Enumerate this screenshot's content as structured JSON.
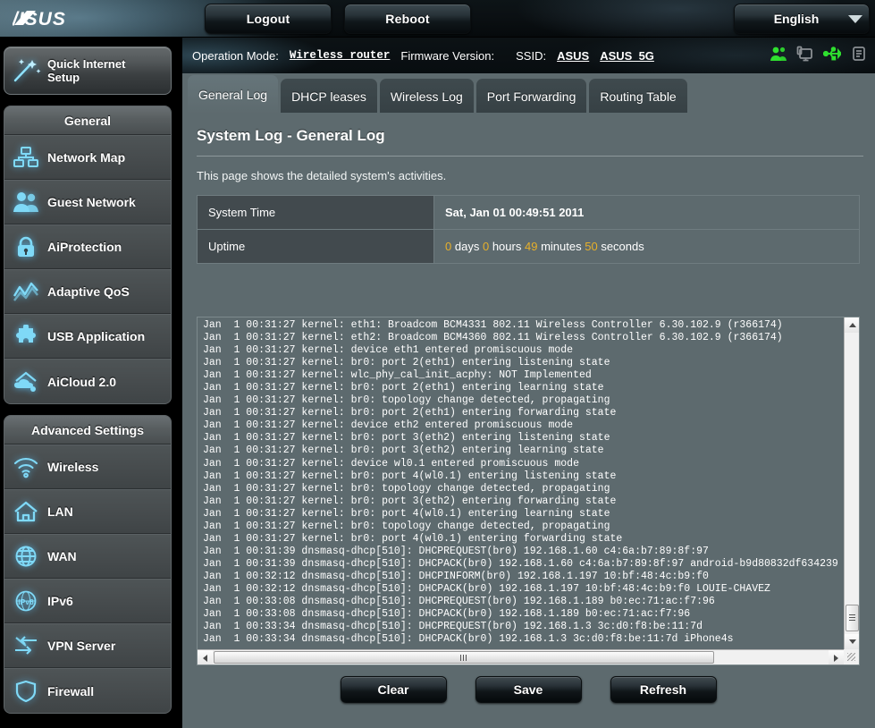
{
  "header": {
    "logo_text": "ASUS",
    "logout_label": "Logout",
    "reboot_label": "Reboot",
    "language_label": "English"
  },
  "opbar": {
    "operation_mode_label": "Operation Mode:",
    "operation_mode_value": "Wireless router",
    "firmware_label": "Firmware Version:",
    "firmware_value": "",
    "ssid_label": "SSID:",
    "ssid_value_1": "ASUS",
    "ssid_value_2": "ASUS_5G",
    "icons": [
      "clients-icon",
      "monitor-icon",
      "usb-icon",
      "printer-icon"
    ]
  },
  "sidebar": {
    "quick_setup": {
      "line1": "Quick Internet",
      "line2": "Setup",
      "icon": "magic-wand-icon"
    },
    "general_header": "General",
    "general_items": [
      {
        "label": "Network Map",
        "icon": "network-map-icon"
      },
      {
        "label": "Guest Network",
        "icon": "guest-network-icon"
      },
      {
        "label": "AiProtection",
        "icon": "lock-icon"
      },
      {
        "label": "Adaptive QoS",
        "icon": "chart-icon"
      },
      {
        "label": "USB Application",
        "icon": "puzzle-icon"
      },
      {
        "label": "AiCloud 2.0",
        "icon": "cloud-home-icon"
      }
    ],
    "advanced_header": "Advanced Settings",
    "advanced_items": [
      {
        "label": "Wireless",
        "icon": "wifi-icon"
      },
      {
        "label": "LAN",
        "icon": "home-icon"
      },
      {
        "label": "WAN",
        "icon": "globe-icon"
      },
      {
        "label": "IPv6",
        "icon": "ipv6-globe-icon"
      },
      {
        "label": "VPN Server",
        "icon": "vpn-arrows-icon"
      },
      {
        "label": "Firewall",
        "icon": "shield-icon"
      }
    ]
  },
  "tabs": [
    {
      "label": "General Log",
      "active": true
    },
    {
      "label": "DHCP leases",
      "active": false
    },
    {
      "label": "Wireless Log",
      "active": false
    },
    {
      "label": "Port Forwarding",
      "active": false
    },
    {
      "label": "Routing Table",
      "active": false
    }
  ],
  "page": {
    "title": "System Log - General Log",
    "description": "This page shows the detailed system's activities."
  },
  "info_table": {
    "system_time_label": "System Time",
    "system_time_value": "Sat, Jan 01  00:49:51  2011",
    "uptime_label": "Uptime",
    "uptime": {
      "days": "0",
      "days_unit": "days",
      "hours": "0",
      "hours_unit": "hours",
      "minutes": "49",
      "minutes_unit": "minutes",
      "seconds": "50",
      "seconds_unit": "seconds"
    }
  },
  "log": {
    "lines": [
      "Jan  1 00:31:27 kernel: eth1: Broadcom BCM4331 802.11 Wireless Controller 6.30.102.9 (r366174)",
      "Jan  1 00:31:27 kernel: eth2: Broadcom BCM4360 802.11 Wireless Controller 6.30.102.9 (r366174)",
      "Jan  1 00:31:27 kernel: device eth1 entered promiscuous mode",
      "Jan  1 00:31:27 kernel: br0: port 2(eth1) entering listening state",
      "Jan  1 00:31:27 kernel: wlc_phy_cal_init_acphy: NOT Implemented",
      "Jan  1 00:31:27 kernel: br0: port 2(eth1) entering learning state",
      "Jan  1 00:31:27 kernel: br0: topology change detected, propagating",
      "Jan  1 00:31:27 kernel: br0: port 2(eth1) entering forwarding state",
      "Jan  1 00:31:27 kernel: device eth2 entered promiscuous mode",
      "Jan  1 00:31:27 kernel: br0: port 3(eth2) entering listening state",
      "Jan  1 00:31:27 kernel: br0: port 3(eth2) entering learning state",
      "Jan  1 00:31:27 kernel: device wl0.1 entered promiscuous mode",
      "Jan  1 00:31:27 kernel: br0: port 4(wl0.1) entering listening state",
      "Jan  1 00:31:27 kernel: br0: topology change detected, propagating",
      "Jan  1 00:31:27 kernel: br0: port 3(eth2) entering forwarding state",
      "Jan  1 00:31:27 kernel: br0: port 4(wl0.1) entering learning state",
      "Jan  1 00:31:27 kernel: br0: topology change detected, propagating",
      "Jan  1 00:31:27 kernel: br0: port 4(wl0.1) entering forwarding state",
      "Jan  1 00:31:39 dnsmasq-dhcp[510]: DHCPREQUEST(br0) 192.168.1.60 c4:6a:b7:89:8f:97",
      "Jan  1 00:31:39 dnsmasq-dhcp[510]: DHCPACK(br0) 192.168.1.60 c4:6a:b7:89:8f:97 android-b9d80832df634239",
      "Jan  1 00:32:12 dnsmasq-dhcp[510]: DHCPINFORM(br0) 192.168.1.197 10:bf:48:4c:b9:f0",
      "Jan  1 00:32:12 dnsmasq-dhcp[510]: DHCPACK(br0) 192.168.1.197 10:bf:48:4c:b9:f0 LOUIE-CHAVEZ",
      "Jan  1 00:33:08 dnsmasq-dhcp[510]: DHCPREQUEST(br0) 192.168.1.189 b0:ec:71:ac:f7:96",
      "Jan  1 00:33:08 dnsmasq-dhcp[510]: DHCPACK(br0) 192.168.1.189 b0:ec:71:ac:f7:96",
      "Jan  1 00:33:34 dnsmasq-dhcp[510]: DHCPREQUEST(br0) 192.168.1.3 3c:d0:f8:be:11:7d",
      "Jan  1 00:33:34 dnsmasq-dhcp[510]: DHCPACK(br0) 192.168.1.3 3c:d0:f8:be:11:7d iPhone4s"
    ]
  },
  "buttons": {
    "clear": "Clear",
    "save": "Save",
    "refresh": "Refresh"
  },
  "colors": {
    "content_bg": "#5d6a6e",
    "key_cell_bg": "#424a4e",
    "accent_yellow": "#e7b02a",
    "status_green": "#2fe02f",
    "icon_blue": "#6fd2f5"
  }
}
